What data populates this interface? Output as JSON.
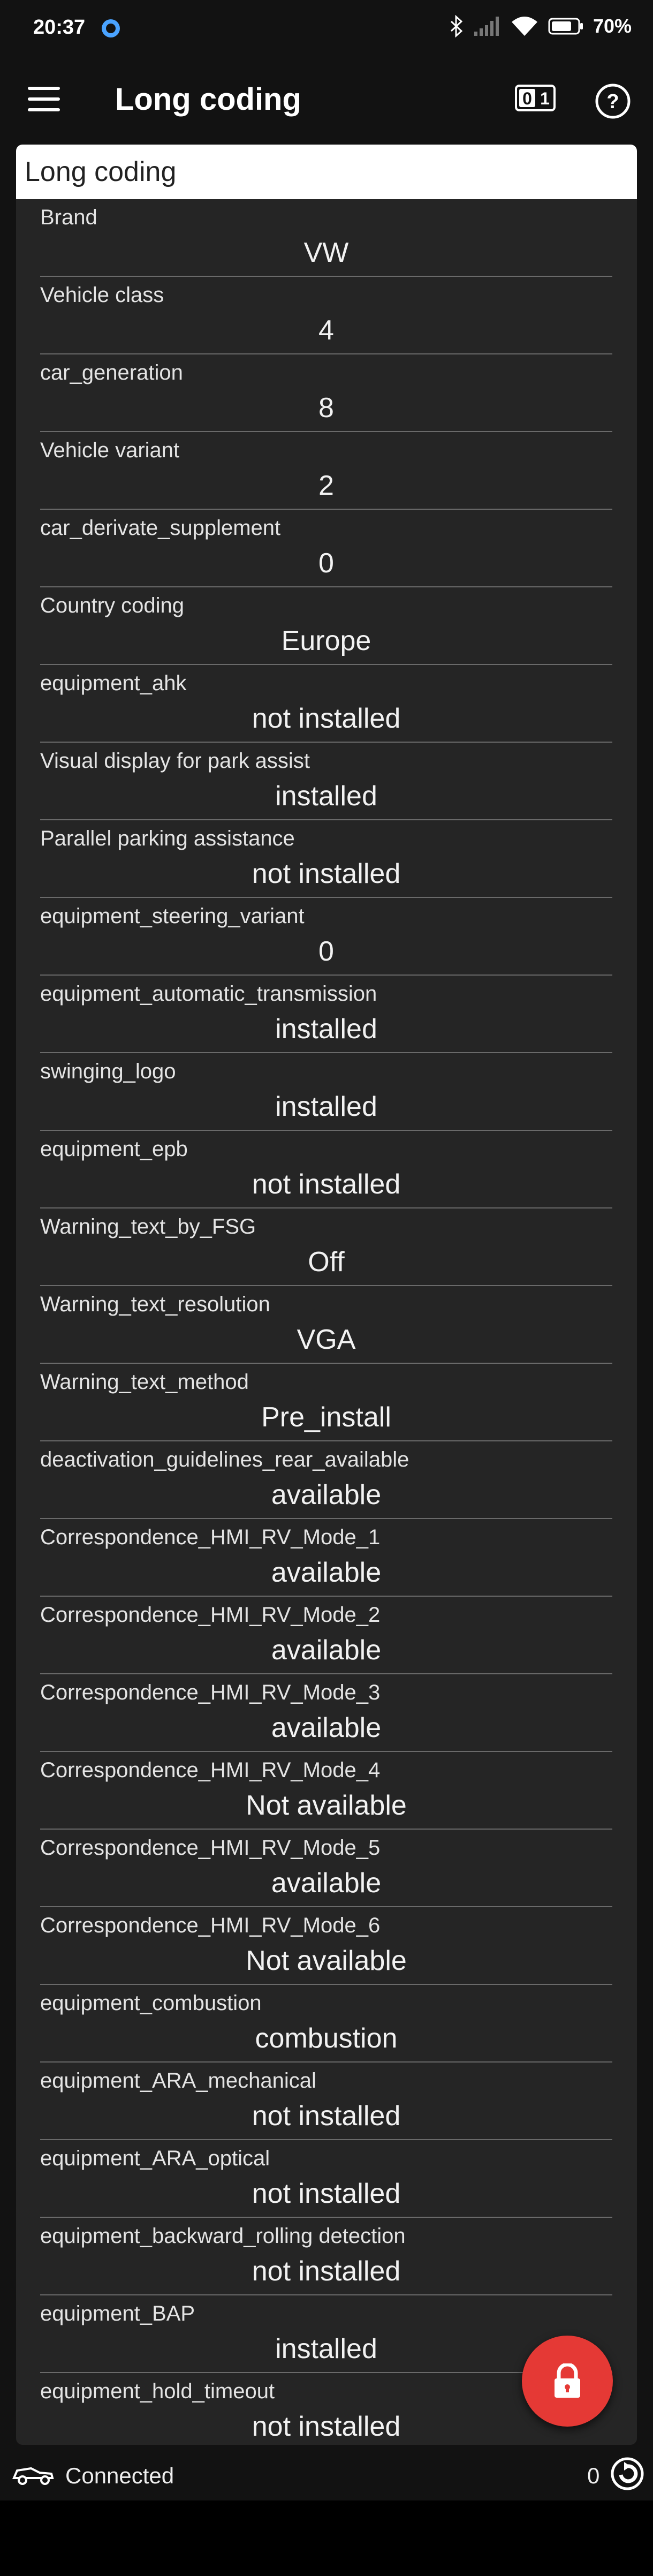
{
  "status_bar": {
    "time": "20:37",
    "battery_percent": "70%"
  },
  "app_bar": {
    "title": "Long coding",
    "menu_icon": "hamburger-menu-icon",
    "obd_icon": "obd-toggle-icon",
    "help_icon": "help-icon"
  },
  "card": {
    "header": "Long coding",
    "items": [
      {
        "label": "Brand",
        "value": "VW"
      },
      {
        "label": "Vehicle class",
        "value": "4"
      },
      {
        "label": "car_generation",
        "value": "8"
      },
      {
        "label": "Vehicle variant",
        "value": "2"
      },
      {
        "label": "car_derivate_supplement",
        "value": "0"
      },
      {
        "label": "Country coding",
        "value": "Europe"
      },
      {
        "label": "equipment_ahk",
        "value": "not installed"
      },
      {
        "label": "Visual display for park assist",
        "value": "installed"
      },
      {
        "label": "Parallel parking assistance",
        "value": "not installed"
      },
      {
        "label": "equipment_steering_variant",
        "value": "0"
      },
      {
        "label": "equipment_automatic_transmission",
        "value": "installed"
      },
      {
        "label": "swinging_logo",
        "value": "installed"
      },
      {
        "label": "equipment_epb",
        "value": "not installed"
      },
      {
        "label": "Warning_text_by_FSG",
        "value": "Off"
      },
      {
        "label": "Warning_text_resolution",
        "value": "VGA"
      },
      {
        "label": "Warning_text_method",
        "value": "Pre_install"
      },
      {
        "label": "deactivation_guidelines_rear_available",
        "value": "available"
      },
      {
        "label": "Correspondence_HMI_RV_Mode_1",
        "value": "available"
      },
      {
        "label": "Correspondence_HMI_RV_Mode_2",
        "value": "available"
      },
      {
        "label": "Correspondence_HMI_RV_Mode_3",
        "value": "available"
      },
      {
        "label": "Correspondence_HMI_RV_Mode_4",
        "value": "Not available"
      },
      {
        "label": "Correspondence_HMI_RV_Mode_5",
        "value": "available"
      },
      {
        "label": "Correspondence_HMI_RV_Mode_6",
        "value": "Not available"
      },
      {
        "label": "equipment_combustion",
        "value": "combustion"
      },
      {
        "label": "equipment_ARA_mechanical",
        "value": "not installed"
      },
      {
        "label": "equipment_ARA_optical",
        "value": "not installed"
      },
      {
        "label": "equipment_backward_rolling detection",
        "value": "not installed"
      },
      {
        "label": "equipment_BAP",
        "value": "installed"
      },
      {
        "label": "equipment_hold_timeout",
        "value": "not installed"
      }
    ]
  },
  "fab": {
    "icon": "lock-icon",
    "color": "#e53935"
  },
  "bottom_bar": {
    "status": "Connected",
    "count": "0",
    "car_icon": "car-icon",
    "refresh_icon": "refresh-icon"
  }
}
